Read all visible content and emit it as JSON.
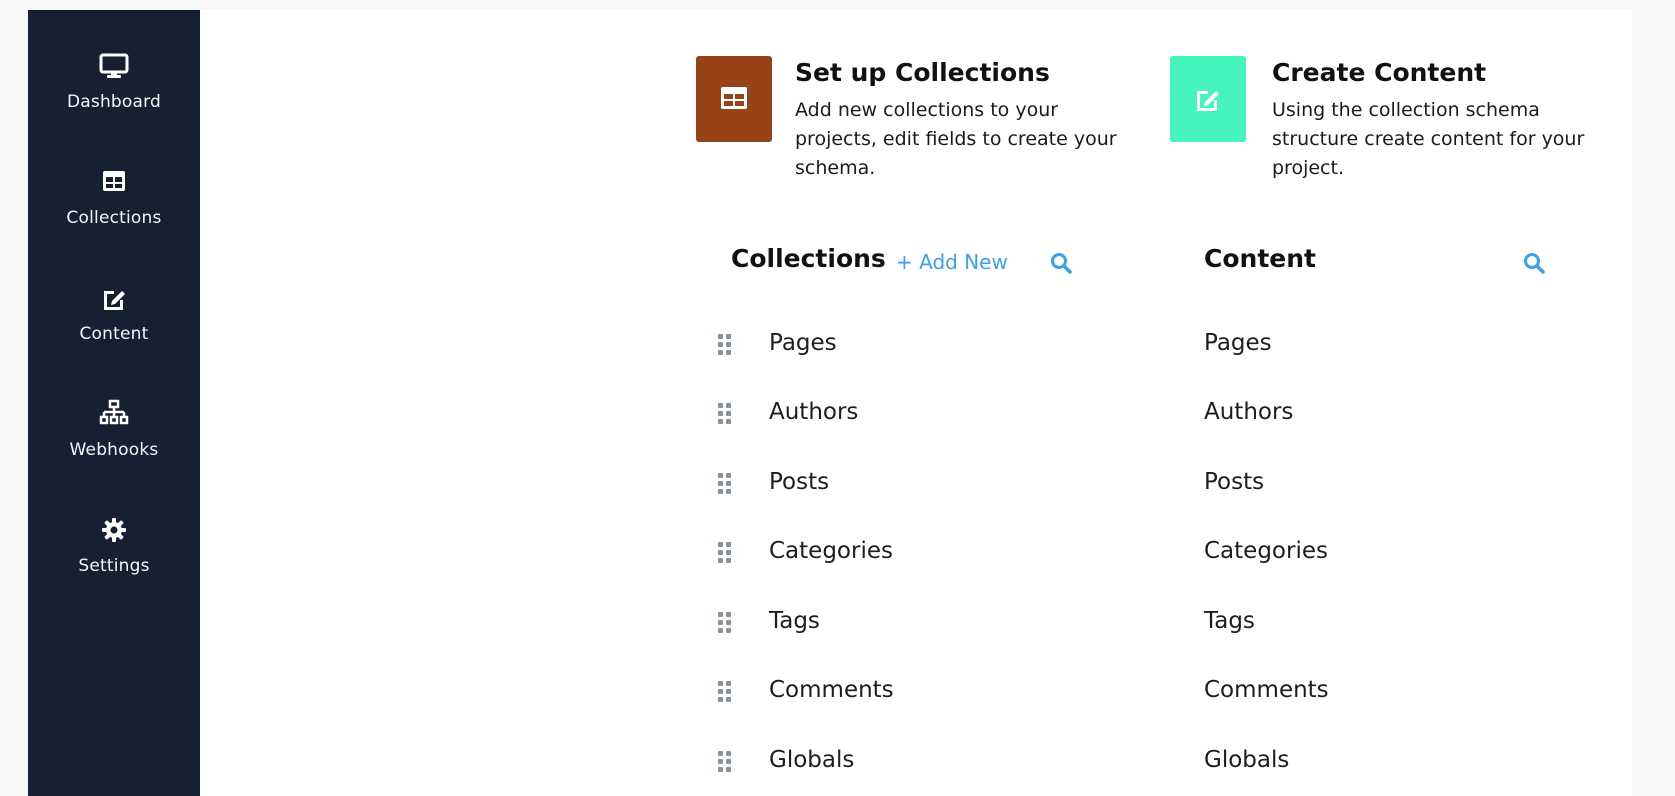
{
  "sidebar": {
    "items": [
      {
        "label": "Dashboard",
        "icon": "monitor-icon"
      },
      {
        "label": "Collections",
        "icon": "table-icon"
      },
      {
        "label": "Content",
        "icon": "edit-icon"
      },
      {
        "label": "Webhooks",
        "icon": "sitemap-icon"
      },
      {
        "label": "Settings",
        "icon": "gear-icon"
      }
    ]
  },
  "cards": {
    "setup": {
      "title": "Set up Collections",
      "desc_lines": [
        "Add new collections to your",
        "projects, edit fields to create your",
        "schema."
      ],
      "icon": "table-icon",
      "color": "#984217"
    },
    "create": {
      "title": "Create Content",
      "desc_lines": [
        "Using the collection schema",
        "structure create content for your",
        "project."
      ],
      "icon": "edit-icon",
      "color": "#45f5bd"
    }
  },
  "collections_panel": {
    "title": "Collections",
    "add_new_label": "+ Add New",
    "search_icon": "search-icon",
    "items": [
      "Pages",
      "Authors",
      "Posts",
      "Categories",
      "Tags",
      "Comments",
      "Globals"
    ]
  },
  "content_panel": {
    "title": "Content",
    "search_icon": "search-icon",
    "items": [
      "Pages",
      "Authors",
      "Posts",
      "Categories",
      "Tags",
      "Comments",
      "Globals"
    ]
  },
  "colors": {
    "sidebar_bg": "#162033",
    "accent_blue": "#3aa0f0"
  }
}
